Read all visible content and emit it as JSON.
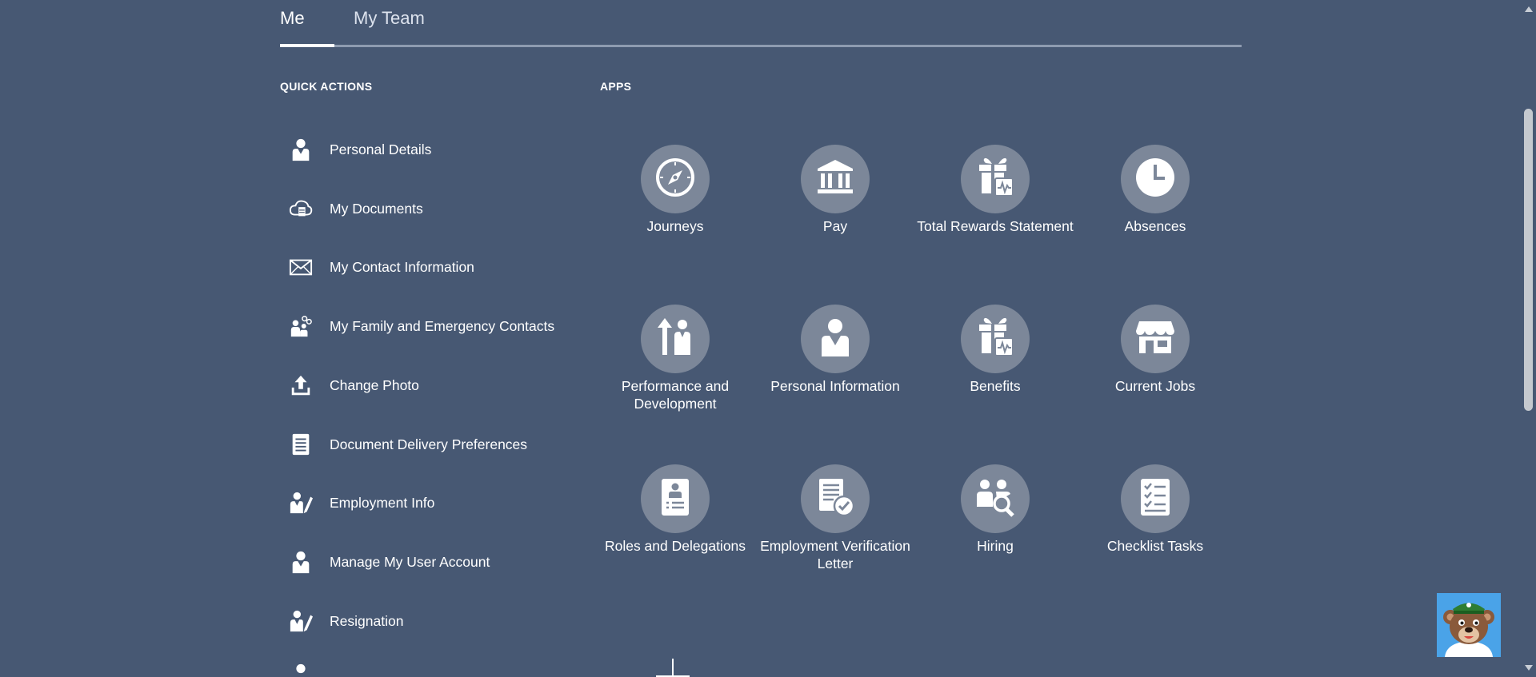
{
  "tabs": [
    {
      "label": "Me"
    },
    {
      "label": "My Team"
    }
  ],
  "quick_actions": {
    "title": "QUICK ACTIONS",
    "items": [
      {
        "label": "Personal Details",
        "icon": "person-icon"
      },
      {
        "label": "My Documents",
        "icon": "cloud-document-icon"
      },
      {
        "label": "My Contact Information",
        "icon": "envelope-icon"
      },
      {
        "label": "My Family and Emergency Contacts",
        "icon": "family-icon"
      },
      {
        "label": "Change Photo",
        "icon": "upload-icon"
      },
      {
        "label": "Document Delivery Preferences",
        "icon": "document-icon"
      },
      {
        "label": "Employment Info",
        "icon": "person-edit-icon"
      },
      {
        "label": "Manage My User Account",
        "icon": "person-icon"
      },
      {
        "label": "Resignation",
        "icon": "person-edit-icon"
      }
    ]
  },
  "apps": {
    "title": "APPS",
    "items": [
      {
        "label": "Journeys",
        "icon": "compass-icon"
      },
      {
        "label": "Pay",
        "icon": "bank-icon"
      },
      {
        "label": "Total Rewards Statement",
        "icon": "gift-chart-icon"
      },
      {
        "label": "Absences",
        "icon": "clock-icon"
      },
      {
        "label": "Performance and Development",
        "icon": "person-growth-icon"
      },
      {
        "label": "Personal Information",
        "icon": "person-icon"
      },
      {
        "label": "Benefits",
        "icon": "gift-chart-icon"
      },
      {
        "label": "Current Jobs",
        "icon": "storefront-icon"
      },
      {
        "label": "Roles and Delegations",
        "icon": "id-badge-icon"
      },
      {
        "label": "Employment Verification Letter",
        "icon": "document-check-icon"
      },
      {
        "label": "Hiring",
        "icon": "people-search-icon"
      },
      {
        "label": "Checklist Tasks",
        "icon": "checklist-icon"
      }
    ]
  },
  "colors": {
    "background": "#475873",
    "app_circle": "#7c8799",
    "text": "#ffffff"
  }
}
